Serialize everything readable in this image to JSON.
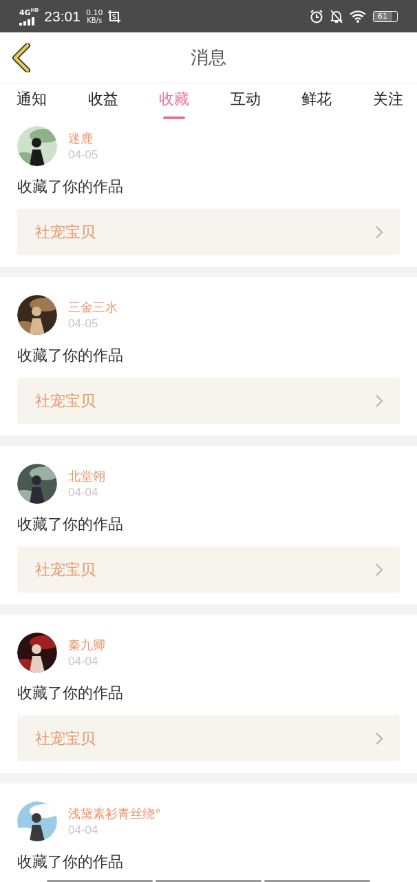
{
  "status_bar": {
    "network": "4G",
    "network_sup": "HD",
    "time": "23:01",
    "speed": "0.10",
    "speed_unit": "KB/s",
    "battery": "61"
  },
  "header": {
    "title": "消息"
  },
  "tabs": [
    {
      "label": "通知",
      "selected": false
    },
    {
      "label": "收益",
      "selected": false
    },
    {
      "label": "收藏",
      "selected": true
    },
    {
      "label": "互动",
      "selected": false
    },
    {
      "label": "鲜花",
      "selected": false
    },
    {
      "label": "关注",
      "selected": false
    }
  ],
  "messages": [
    {
      "name": "迷鹿",
      "date": "04-05",
      "text": "收藏了你的作品",
      "work": "社宠宝贝"
    },
    {
      "name": "三金三水",
      "date": "04-05",
      "text": "收藏了你的作品",
      "work": "社宠宝贝"
    },
    {
      "name": "北堂翎",
      "date": "04-04",
      "text": "收藏了你的作品",
      "work": "社宠宝贝"
    },
    {
      "name": "秦九卿",
      "date": "04-04",
      "text": "收藏了你的作品",
      "work": "社宠宝贝"
    },
    {
      "name": "浅黛素衫青丝绕°",
      "date": "04-04",
      "text": "收藏了你的作品"
    }
  ]
}
